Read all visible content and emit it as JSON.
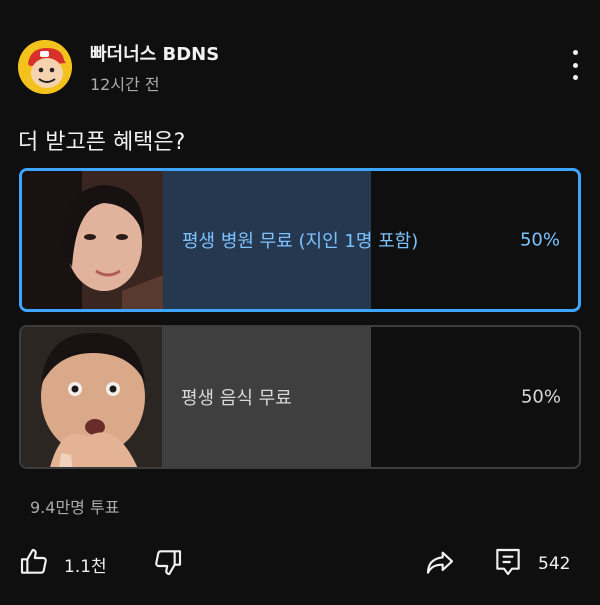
{
  "post": {
    "channel_name": "빠더너스 BDNS",
    "time_ago": "12시간 전",
    "question": "더 받고픈 혜택은?"
  },
  "poll": {
    "options": [
      {
        "label": "평생 병원 무료 (지인 1명 포함)",
        "percent_text": "50%",
        "percent": 0.5,
        "selected": true
      },
      {
        "label": "평생 음식 무료",
        "percent_text": "50%",
        "percent": 0.5,
        "selected": false
      }
    ],
    "vote_count": "9.4만명 투표"
  },
  "actions": {
    "like_count": "1.1천",
    "comment_count": "542"
  },
  "icons": [
    "more-vert-icon",
    "thumbs-up-icon",
    "thumbs-down-icon",
    "share-icon",
    "comment-icon"
  ],
  "colors": {
    "background": "#0f0f0f",
    "accent": "#3ea6ff",
    "selected_fill": "#263850",
    "unselected_fill": "#3f3f3f"
  }
}
